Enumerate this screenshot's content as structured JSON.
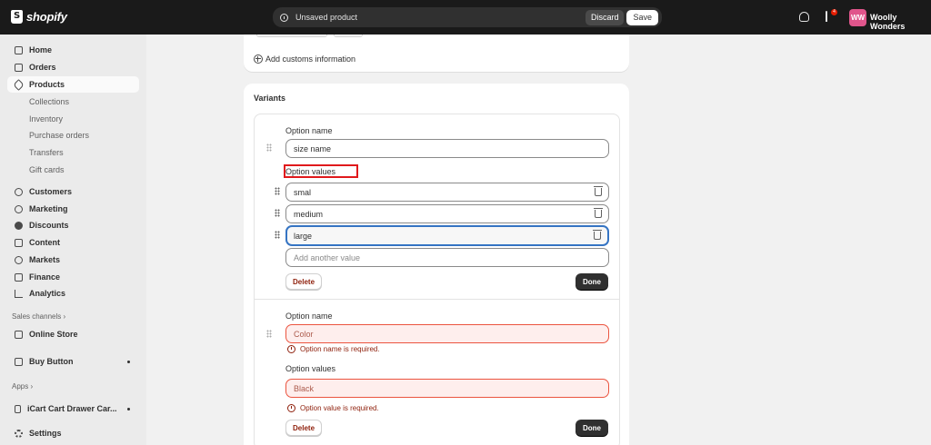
{
  "topbar": {
    "brand": "shopify",
    "unsaved_title": "Unsaved product",
    "discard_label": "Discard",
    "save_label": "Save",
    "notification_count": "4",
    "avatar_initials": "WW",
    "store_name": "Woolly Wonders"
  },
  "sidebar": {
    "home": "Home",
    "orders": "Orders",
    "products": "Products",
    "collections": "Collections",
    "inventory": "Inventory",
    "purchase_orders": "Purchase orders",
    "transfers": "Transfers",
    "gift_cards": "Gift cards",
    "customers": "Customers",
    "marketing": "Marketing",
    "discounts": "Discounts",
    "content": "Content",
    "markets": "Markets",
    "finance": "Finance",
    "analytics": "Analytics",
    "sales_channels": "Sales channels",
    "online_store": "Online Store",
    "buy_button": "Buy Button",
    "apps": "Apps",
    "icart": "iCart Cart Drawer Car...",
    "settings": "Settings"
  },
  "customs": {
    "add_label": "Add customs information"
  },
  "variants": {
    "title": "Variants",
    "option1": {
      "name_label": "Option name",
      "name_value": "size name",
      "values_label": "Option values",
      "values": [
        "smal",
        "medium",
        "large"
      ],
      "add_placeholder": "Add another value",
      "delete_label": "Delete",
      "done_label": "Done"
    },
    "option2": {
      "name_label": "Option name",
      "name_placeholder": "Color",
      "name_error": "Option name is required.",
      "values_label": "Option values",
      "value_placeholder": "Black",
      "value_error": "Option value is required.",
      "delete_label": "Delete",
      "done_label": "Done"
    }
  }
}
